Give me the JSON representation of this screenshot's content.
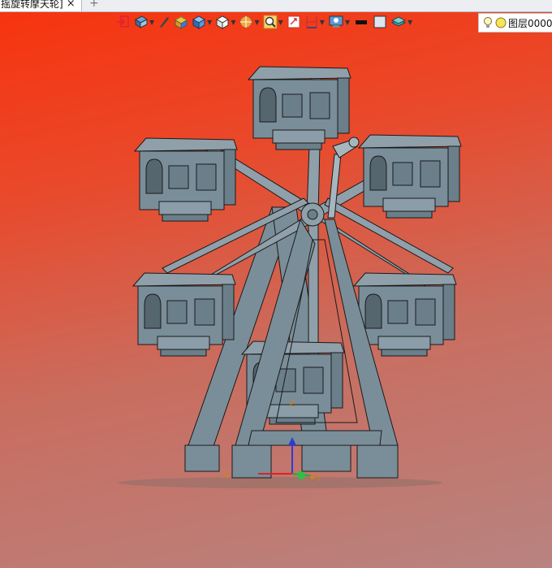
{
  "tab": {
    "title": "摇旋转摩天轮]",
    "close_icon": "×",
    "new_icon": "+"
  },
  "toolbar": {
    "items": [
      {
        "icon": "exit-sketch-icon",
        "dropdown": false
      },
      {
        "icon": "view-orientation-icon",
        "dropdown": true
      },
      {
        "icon": "pen-icon",
        "dropdown": false
      },
      {
        "icon": "part-box-icon",
        "dropdown": false
      },
      {
        "icon": "shaded-cube-icon",
        "dropdown": true
      },
      {
        "icon": "display-cube-icon",
        "dropdown": true
      },
      {
        "icon": "section-view-icon",
        "dropdown": true
      },
      {
        "icon": "zoom-icon",
        "dropdown": true
      },
      {
        "icon": "fit-view-icon",
        "dropdown": false
      },
      {
        "icon": "measure-icon",
        "dropdown": true
      },
      {
        "icon": "render-monitor-icon",
        "dropdown": true
      },
      {
        "icon": "line-color-icon",
        "dropdown": false
      },
      {
        "icon": "fill-color-icon",
        "dropdown": false
      },
      {
        "icon": "layer-stack-icon",
        "dropdown": true
      }
    ]
  },
  "layer": {
    "label": "图层0000",
    "icons": [
      "lightbulb-icon",
      "visibility-dot-icon"
    ]
  },
  "triad": {
    "x_label": "X",
    "y_label": "Y",
    "z_label": "Z"
  },
  "colors": {
    "model": "#7a8e99",
    "model_edge": "#1a1a1a",
    "background_top": "#f8320d",
    "background_bottom": "#b88380"
  }
}
